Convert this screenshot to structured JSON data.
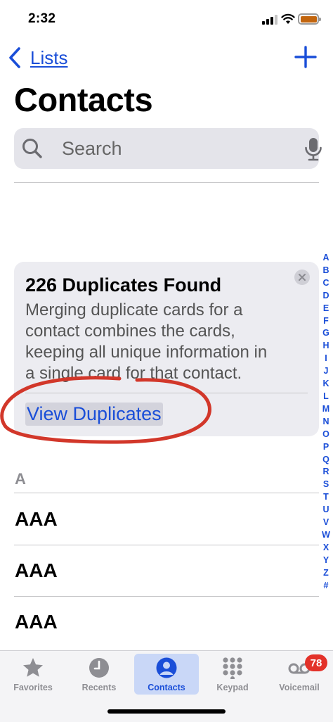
{
  "status_bar": {
    "time": "2:32"
  },
  "nav": {
    "back_label": "Lists",
    "add_icon": "plus-icon"
  },
  "page": {
    "title": "Contacts"
  },
  "search": {
    "placeholder": "Search",
    "icon": "magnifying-glass",
    "mic_icon": "microphone"
  },
  "duplicates_card": {
    "title": "226 Duplicates Found",
    "body_lines": [
      "Merging duplicate cards for a",
      "contact combines the cards,",
      "keeping all unique information in",
      "a single card for that contact."
    ],
    "action_label": "View Duplicates",
    "annotation_color": "#d2372a"
  },
  "contacts": {
    "section_header": "A",
    "rows": [
      {
        "name": "AAA"
      },
      {
        "name": "AAA"
      },
      {
        "name": "AAA"
      }
    ]
  },
  "index_letters": [
    "A",
    "B",
    "C",
    "D",
    "E",
    "F",
    "G",
    "H",
    "I",
    "J",
    "K",
    "L",
    "M",
    "N",
    "O",
    "P",
    "Q",
    "R",
    "S",
    "T",
    "U",
    "V",
    "W",
    "X",
    "Y",
    "Z",
    "#"
  ],
  "tab_bar": {
    "tabs": [
      {
        "label": "Favorites",
        "icon": "star-icon",
        "active": false
      },
      {
        "label": "Recents",
        "icon": "clock-icon",
        "active": false
      },
      {
        "label": "Contacts",
        "icon": "person-circle-icon",
        "active": true
      },
      {
        "label": "Keypad",
        "icon": "keypad-icon",
        "active": false
      },
      {
        "label": "Voicemail",
        "icon": "voicemail-icon",
        "active": false
      }
    ],
    "voicemail_badge": "78"
  },
  "colors": {
    "accent": "#1a4ed8",
    "badge": "#e3322a",
    "battery": "#c2650e",
    "active_tab_bg": "#c9d7f7"
  }
}
